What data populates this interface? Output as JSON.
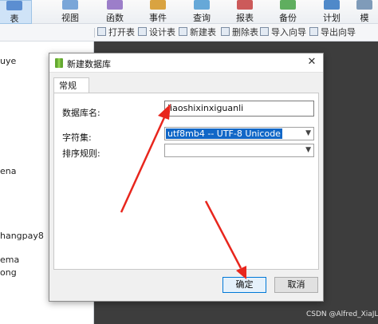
{
  "ribbon": {
    "items": [
      {
        "label": "表",
        "icon": "table-icon"
      },
      {
        "label": "视图",
        "icon": "view-icon"
      },
      {
        "label": "函数",
        "icon": "function-icon"
      },
      {
        "label": "事件",
        "icon": "event-icon"
      },
      {
        "label": "查询",
        "icon": "query-icon"
      },
      {
        "label": "报表",
        "icon": "report-icon"
      },
      {
        "label": "备份",
        "icon": "backup-icon"
      },
      {
        "label": "计划",
        "icon": "schedule-icon"
      },
      {
        "label": "模",
        "icon": "model-icon"
      }
    ]
  },
  "toolbar": {
    "open_table": "打开表",
    "design_table": "设计表",
    "new_table": "新建表",
    "delete_table": "删除表",
    "import_wizard": "导入向导",
    "export_wizard": "导出向导"
  },
  "left_panel": {
    "items": [
      "uye",
      "ena",
      "hangpay8",
      "ema",
      "ong"
    ]
  },
  "dialog": {
    "title": "新建数据库",
    "tab": "常规",
    "fields": {
      "db_name_label": "数据库名:",
      "db_name_value": "jiaoshixinxiguanli",
      "charset_label": "字符集:",
      "charset_value": "utf8mb4 -- UTF-8 Unicode",
      "collation_label": "排序规则:",
      "collation_value": ""
    },
    "ok": "确定",
    "cancel": "取消"
  },
  "watermark": "CSDN @Alfred_XiaJL",
  "colors": {
    "selection": "#1167c7",
    "annotation_arrow": "#e8261d",
    "dark_background": "#3d3d3d"
  }
}
